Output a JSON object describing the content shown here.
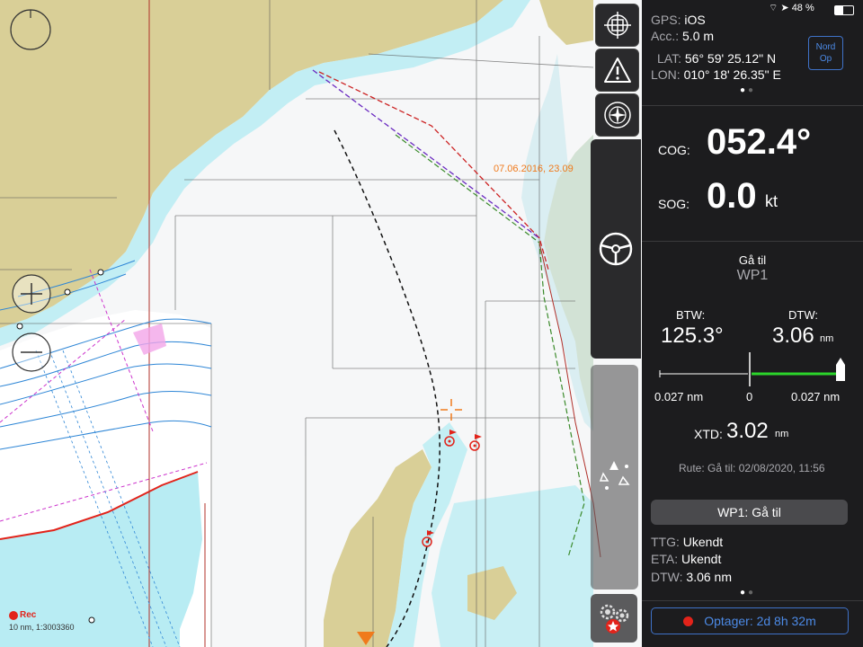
{
  "map": {
    "date_stamp": "07.06.2016, 23.09",
    "rec_label": "Rec",
    "scale_label": "10 nm, 1:3003360"
  },
  "status_bar": {
    "battery": "48 %"
  },
  "toolbar": {
    "items": [
      {
        "name": "target-crosshair-icon"
      },
      {
        "name": "warning-icon"
      },
      {
        "name": "compass-icon"
      },
      {
        "name": "steering-wheel-icon"
      },
      {
        "name": "ais-targets-icon"
      },
      {
        "name": "settings-gears-icon"
      }
    ]
  },
  "gps": {
    "gps_label": "GPS:",
    "gps_value": "iOS",
    "acc_label": "Acc.:",
    "acc_value": "5.0 m",
    "lat_label": "LAT:",
    "lat_value": "56° 59' 25.12\" N",
    "lon_label": "LON:",
    "lon_value": "010° 18' 26.35\" E",
    "north_up_line1": "Nord",
    "north_up_line2": "Op"
  },
  "nav": {
    "cog_label": "COG:",
    "cog_value": "052.4°",
    "sog_label": "SOG:",
    "sog_value": "0.0",
    "sog_unit": "kt"
  },
  "goto": {
    "title": "Gå til",
    "waypoint": "WP1",
    "btw_label": "BTW:",
    "btw_value": "125.3°",
    "dtw_label": "DTW:",
    "dtw_value": "3.06",
    "dtw_unit": "nm",
    "scale_left": "0.027 nm",
    "scale_center": "0",
    "scale_right": "0.027 nm",
    "xtd_label": "XTD:",
    "xtd_value": "3.02",
    "xtd_unit": "nm",
    "route_text": "Rute: Gå til: 02/08/2020, 11:56",
    "button_label": "WP1: Gå til",
    "ttg_label": "TTG:",
    "ttg_value": "Ukendt",
    "eta_label": "ETA:",
    "eta_value": "Ukendt",
    "dtw2_label": "DTW:",
    "dtw2_value": "3.06 nm"
  },
  "recorder": {
    "label": "Optager: 2d 8h 32m"
  },
  "colors": {
    "land": "#d9cf97",
    "sea_white": "#ffffff",
    "shallow": "#b8ecf3",
    "panel": "#1c1c1e",
    "accent_blue": "#3f72c8",
    "xtd_green": "#2bd52b",
    "rec_red": "#e2231a",
    "date_orange": "#f07a1c"
  }
}
